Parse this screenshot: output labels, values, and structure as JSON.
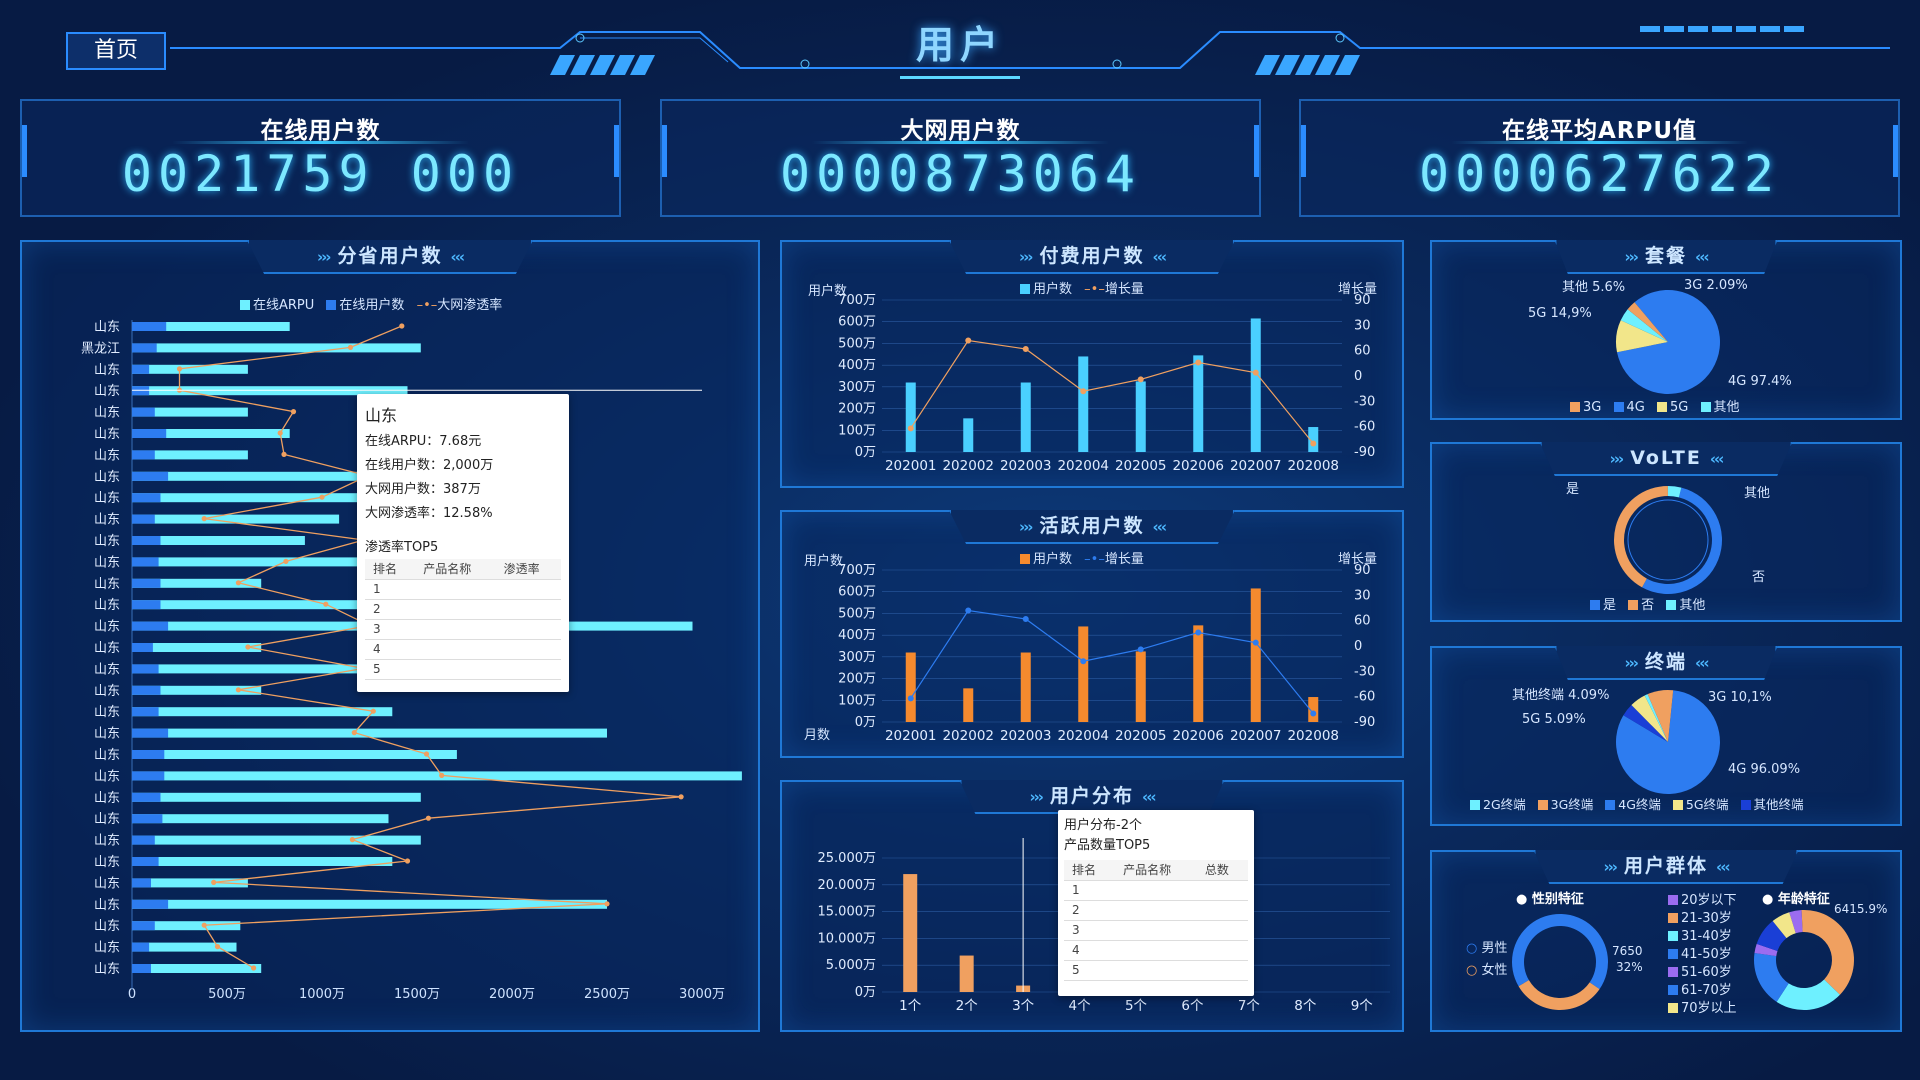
{
  "header": {
    "home_label": "首页",
    "title": "用户"
  },
  "kpis": [
    {
      "label": "在线用户数",
      "value": "0021759 000"
    },
    {
      "label": "大网用户数",
      "value": "0000873064"
    },
    {
      "label": "在线平均ARPU值",
      "value": "0000627622"
    }
  ],
  "province_panel": {
    "title": "分省用户数",
    "legend": [
      "在线ARPU",
      "在线用户数",
      "大网渗透率"
    ],
    "colors": {
      "arpu": "#6ef0ff",
      "users": "#2d7cf0",
      "rate": "#f0a060"
    },
    "x_ticks": [
      "0",
      "500万",
      "1000万",
      "1500万",
      "2000万",
      "2500万",
      "3000万"
    ],
    "tooltip": {
      "title": "山东",
      "lines": [
        "在线ARPU：7.68元",
        "在线用户数：2,000万",
        "大网用户数：387万",
        "大网渗透率：12.58%"
      ],
      "table_title": "渗透率TOP5",
      "headers": [
        "排名",
        "产品名称",
        "渗透率"
      ],
      "ranks": [
        "1",
        "2",
        "3",
        "4",
        "5"
      ]
    }
  },
  "paid_panel": {
    "title": "付费用户数",
    "ylabel_left": "用户数",
    "ylabel_right": "增长量",
    "legend": [
      "用户数",
      "增长量"
    ],
    "y_left": [
      "700万",
      "600万",
      "500万",
      "400万",
      "300万",
      "200万",
      "100万",
      "0万"
    ],
    "y_right": [
      "90",
      "30",
      "60",
      "0",
      "-30",
      "-60",
      "-90"
    ]
  },
  "active_panel": {
    "title": "活跃用户数",
    "ylabel_left": "用户数",
    "ylabel_right": "增长量",
    "xlabel": "月数",
    "legend": [
      "用户数",
      "增长量"
    ],
    "y_left": [
      "700万",
      "600万",
      "500万",
      "400万",
      "300万",
      "200万",
      "100万",
      "0万"
    ],
    "y_right": [
      "90",
      "30",
      "60",
      "0",
      "-30",
      "-60",
      "-90"
    ]
  },
  "dist_panel": {
    "title": "用户分布",
    "y_ticks": [
      "25.000万",
      "20.000万",
      "15.000万",
      "10.000万",
      "5.000万",
      "0万"
    ],
    "tooltip": {
      "line1": "用户分布-2个",
      "line2": "产品数量TOP5",
      "headers": [
        "排名",
        "产品名称",
        "总数"
      ],
      "ranks": [
        "1",
        "2",
        "3",
        "4",
        "5"
      ]
    }
  },
  "package_panel": {
    "title": "套餐",
    "labels": [
      "其他 5.6%",
      "3G  2.09%",
      "5G 14,9%",
      "4G 97.4%"
    ],
    "legend": [
      "3G",
      "4G",
      "5G",
      "其他"
    ],
    "colors": [
      "#f0a060",
      "#2d7cf0",
      "#f2e68a",
      "#6ef0ff"
    ]
  },
  "volte_panel": {
    "title": "VoLTE",
    "labels": [
      "是",
      "其他",
      "否"
    ],
    "legend": [
      "是",
      "否",
      "其他"
    ],
    "colors": [
      "#2d7cf0",
      "#f0a060",
      "#6ef0ff"
    ]
  },
  "terminal_panel": {
    "title": "终端",
    "labels": [
      "其他终端   4.09%",
      "3G  10,1%",
      "5G  5.09%",
      "4G  96.09%"
    ],
    "legend": [
      "2G终端",
      "3G终端",
      "4G终端",
      "5G终端",
      "其他终端"
    ],
    "colors": [
      "#6ef0ff",
      "#f0a060",
      "#2d7cf0",
      "#f2e68a",
      "#1a3fd6"
    ]
  },
  "group_panel": {
    "title": "用户群体",
    "gender_title": "性别特征",
    "age_title": "年龄特征",
    "gender_legend": [
      "男性",
      "女性"
    ],
    "gender_value": "7650",
    "gender_pct": "32%",
    "age_pct": "6415.9%",
    "age_legend": [
      "20岁以下",
      "21-30岁",
      "31-40岁",
      "41-50岁",
      "51-60岁",
      "61-70岁",
      "70岁以上"
    ],
    "age_colors": [
      "#9b6cf0",
      "#f0a060",
      "#6ef0ff",
      "#2d7cf0",
      "#9b6cf0",
      "#2d7cf0",
      "#f2e68a"
    ]
  },
  "chart_data": [
    {
      "type": "bar",
      "title": "分省用户数",
      "categories": [
        "山东",
        "黑龙江",
        "山东",
        "山东",
        "山东",
        "山东",
        "山东",
        "山东",
        "山东",
        "山东",
        "山东",
        "山东",
        "山东",
        "山东",
        "山东",
        "山东",
        "山东",
        "山东",
        "山东",
        "山东",
        "山东",
        "山东",
        "山东",
        "山东",
        "山东",
        "山东",
        "山东",
        "山东",
        "山东",
        "山东",
        "山东"
      ],
      "series": [
        {
          "name": "在线ARPU",
          "values": [
            830,
            1520,
            610,
            1450,
            610,
            830,
            610,
            1340,
            1350,
            1090,
            910,
            1370,
            680,
            1340,
            2950,
            680,
            1340,
            680,
            1370,
            2500,
            1710,
            3210,
            1520,
            1350,
            1520,
            1370,
            610,
            2500,
            570,
            550,
            680
          ]
        },
        {
          "name": "在线用户数",
          "values": [
            180,
            130,
            90,
            90,
            120,
            180,
            120,
            190,
            150,
            120,
            150,
            140,
            150,
            150,
            190,
            110,
            140,
            150,
            140,
            190,
            170,
            170,
            150,
            160,
            120,
            140,
            100,
            190,
            120,
            90,
            100
          ]
        },
        {
          "name": "大网渗透率",
          "values": [
            1420,
            1150,
            250,
            250,
            850,
            780,
            800,
            1240,
            1000,
            380,
            1220,
            810,
            560,
            1020,
            1250,
            610,
            1220,
            560,
            1270,
            1170,
            1550,
            1630,
            2890,
            1560,
            1160,
            1450,
            430,
            2500,
            380,
            450,
            640
          ]
        }
      ],
      "xlim": [
        0,
        3000
      ]
    },
    {
      "type": "bar",
      "title": "付费用户数",
      "categories": [
        "202001",
        "202002",
        "202003",
        "202004",
        "202005",
        "202006",
        "202007",
        "202008"
      ],
      "series": [
        {
          "name": "用户数",
          "values": [
            320,
            155,
            320,
            440,
            325,
            445,
            615,
            115
          ]
        },
        {
          "name": "增长量",
          "values": [
            -62,
            42,
            32,
            -18,
            -4,
            16,
            4,
            -80
          ]
        }
      ],
      "ylim": [
        0,
        700
      ],
      "y2lim": [
        -90,
        90
      ]
    },
    {
      "type": "bar",
      "title": "活跃用户数",
      "xlabel": "月数",
      "categories": [
        "202001",
        "202002",
        "202003",
        "202004",
        "202005",
        "202006",
        "202007",
        "202008"
      ],
      "series": [
        {
          "name": "用户数",
          "values": [
            320,
            155,
            320,
            440,
            325,
            445,
            615,
            115
          ]
        },
        {
          "name": "增长量",
          "values": [
            -62,
            42,
            32,
            -18,
            -4,
            16,
            4,
            -80
          ]
        }
      ],
      "ylim": [
        0,
        700
      ],
      "y2lim": [
        -90,
        90
      ]
    },
    {
      "type": "bar",
      "title": "用户分布",
      "categories": [
        "1个",
        "2个",
        "3个",
        "4个",
        "5个",
        "6个",
        "7个",
        "8个",
        "9个"
      ],
      "series": [
        {
          "name": "用户分布",
          "values": [
            22,
            6.8,
            1.2,
            0,
            0,
            0,
            0,
            0,
            0
          ]
        }
      ],
      "ylim": [
        0,
        25
      ]
    },
    {
      "type": "pie",
      "title": "套餐",
      "categories": [
        "4G",
        "5G",
        "其他",
        "3G"
      ],
      "values": [
        83,
        10,
        4,
        3
      ]
    },
    {
      "type": "pie",
      "title": "VoLTE",
      "categories": [
        "是",
        "否",
        "其他"
      ],
      "values": [
        54,
        42,
        4
      ]
    },
    {
      "type": "pie",
      "title": "终端",
      "categories": [
        "4G终端",
        "其他终端",
        "5G终端",
        "2G终端",
        "3G终端"
      ],
      "values": [
        82,
        4,
        5,
        1,
        8
      ]
    },
    {
      "type": "pie",
      "title": "性别特征",
      "categories": [
        "男性",
        "女性"
      ],
      "values": [
        68,
        32
      ]
    },
    {
      "type": "pie",
      "title": "年龄特征",
      "categories": [
        "20岁以下",
        "21-30岁",
        "31-40岁",
        "41-50岁",
        "51-60岁",
        "61-70岁",
        "70岁以上"
      ],
      "values": [
        4,
        38,
        22,
        18,
        3,
        9,
        6
      ]
    }
  ]
}
